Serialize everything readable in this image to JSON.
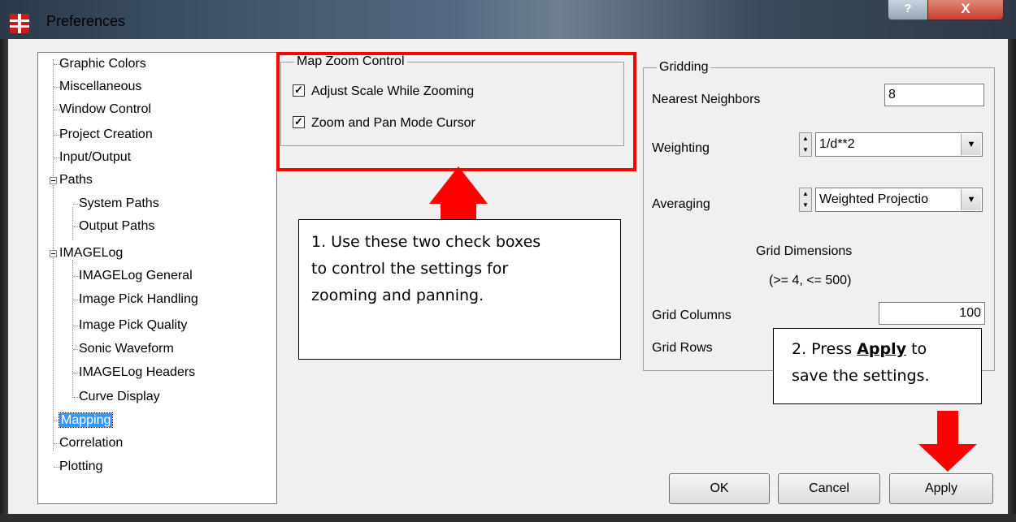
{
  "window": {
    "title": "Preferences",
    "help_label": "?",
    "close_label": "X"
  },
  "tree": {
    "items": [
      {
        "label": "Graphic Colors"
      },
      {
        "label": "Miscellaneous"
      },
      {
        "label": "Window Control"
      },
      {
        "label": "Project Creation"
      },
      {
        "label": "Input/Output"
      },
      {
        "label": "Paths"
      },
      {
        "label": "System Paths"
      },
      {
        "label": "Output Paths"
      },
      {
        "label": "IMAGELog"
      },
      {
        "label": "IMAGELog General"
      },
      {
        "label": "Image Pick Handling"
      },
      {
        "label": "Image Pick Quality"
      },
      {
        "label": "Sonic Waveform"
      },
      {
        "label": "IMAGELog Headers"
      },
      {
        "label": "Curve Display"
      },
      {
        "label": "Mapping"
      },
      {
        "label": "Correlation"
      },
      {
        "label": "Plotting"
      }
    ],
    "selected": "Mapping"
  },
  "map_zoom": {
    "legend": "Map Zoom Control",
    "adjust_scale_label": "Adjust Scale While Zooming",
    "adjust_scale_checked": true,
    "zoom_pan_label": "Zoom and Pan Mode Cursor",
    "zoom_pan_checked": true,
    "check_mark": "✓"
  },
  "gridding": {
    "legend": "Gridding",
    "nearest_neighbors_label": "Nearest Neighbors",
    "nearest_neighbors_value": "8",
    "weighting_label": "Weighting",
    "weighting_value": "1/d**2",
    "averaging_label": "Averaging",
    "averaging_value": "Weighted Projectio",
    "grid_dimensions_label": "Grid Dimensions",
    "grid_dimensions_range": "(>= 4, <= 500)",
    "grid_columns_label": "Grid Columns",
    "grid_columns_value": "100",
    "grid_rows_label": "Grid Rows"
  },
  "callouts": {
    "one": {
      "line1": "1. Use these two check boxes",
      "line2": "to control the settings for",
      "line3": "zooming and panning."
    },
    "two": {
      "prefix": "2. Press ",
      "bold": "Apply",
      "suffix": " to",
      "line2": "save the settings."
    }
  },
  "buttons": {
    "ok": "OK",
    "cancel": "Cancel",
    "apply": "Apply"
  },
  "colors": {
    "highlight": "#ff0000",
    "selection": "#3399ff"
  }
}
